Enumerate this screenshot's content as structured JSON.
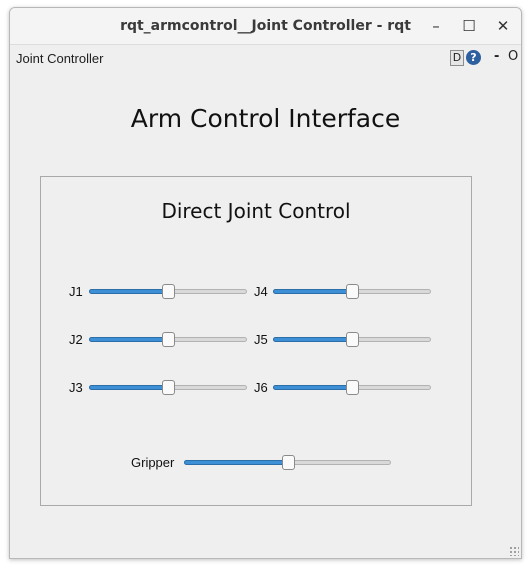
{
  "window": {
    "title": "rqt_armcontrol__Joint Controller - rqt",
    "minimize_icon": "minimize-icon",
    "maximize_icon": "maximize-icon",
    "close_icon": "close-icon",
    "minimize_glyph": "–",
    "maximize_glyph": "☐",
    "close_glyph": "✕"
  },
  "plugin": {
    "label": "Joint Controller",
    "d_label": "D",
    "help_glyph": "?",
    "dash_label": "-",
    "o_label": "O"
  },
  "main_title": "Arm Control Interface",
  "group": {
    "title": "Direct Joint Control",
    "joints": [
      {
        "label": "J1",
        "value": 0.5
      },
      {
        "label": "J2",
        "value": 0.5
      },
      {
        "label": "J3",
        "value": 0.5
      },
      {
        "label": "J4",
        "value": 0.5
      },
      {
        "label": "J5",
        "value": 0.5
      },
      {
        "label": "J6",
        "value": 0.5
      }
    ],
    "gripper": {
      "label": "Gripper",
      "value": 0.5
    }
  },
  "colors": {
    "slider_fill": "#3d8fd6",
    "help_icon": "#2e5f9e"
  }
}
